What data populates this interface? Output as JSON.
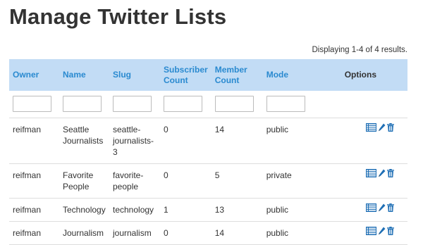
{
  "page": {
    "title": "Manage Twitter Lists"
  },
  "summary": "Displaying 1-4 of 4 results.",
  "columns": {
    "owner": "Owner",
    "name": "Name",
    "slug": "Slug",
    "subscriber_count": [
      "Subscriber",
      "Count"
    ],
    "member_count": [
      "Member",
      "Count"
    ],
    "mode": "Mode",
    "options": "Options"
  },
  "filters": {
    "owner": "",
    "name": "",
    "slug": "",
    "subscriber_count": "",
    "member_count": "",
    "mode": ""
  },
  "rows": [
    {
      "owner": "reifman",
      "name_lines": [
        "Seattle",
        "Journalists"
      ],
      "slug_lines": [
        "seattle-",
        "journalists-",
        "3"
      ],
      "subscribers": "0",
      "members": "14",
      "mode": "public"
    },
    {
      "owner": "reifman",
      "name_lines": [
        "Favorite",
        "People"
      ],
      "slug_lines": [
        "favorite-",
        "people"
      ],
      "subscribers": "0",
      "members": "5",
      "mode": "private"
    },
    {
      "owner": "reifman",
      "name_lines": [
        "Technology"
      ],
      "slug_lines": [
        "technology"
      ],
      "subscribers": "1",
      "members": "13",
      "mode": "public"
    },
    {
      "owner": "reifman",
      "name_lines": [
        "Journalism"
      ],
      "slug_lines": [
        "journalism"
      ],
      "subscribers": "0",
      "members": "14",
      "mode": "public"
    }
  ],
  "row_actions": [
    "list-icon",
    "pencil-icon",
    "trash-icon"
  ],
  "colors": {
    "header_bg": "#c2dcf5",
    "link": "#2a8ad0",
    "icon": "#1f6fb5"
  }
}
